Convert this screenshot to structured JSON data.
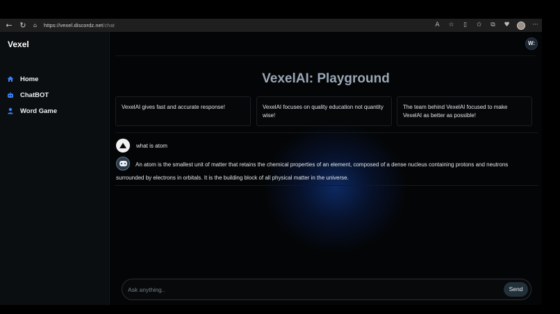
{
  "browser": {
    "back_glyph": "←",
    "refresh_glyph": "↻",
    "lock_glyph": "⌂",
    "url_host": "https://vexel.discordz.net",
    "url_path": "/chat",
    "tool_glyphs": [
      "A",
      "☆",
      "▯",
      "✩",
      "⧉",
      "♥"
    ],
    "menu_glyph": "···"
  },
  "sidebar": {
    "brand": "Vexel",
    "items": [
      {
        "label": "Home",
        "icon": "home-icon",
        "color": "#3b82f6"
      },
      {
        "label": "ChatBOT",
        "icon": "robot-icon",
        "color": "#3b82f6"
      },
      {
        "label": "Word Game",
        "icon": "user-icon",
        "color": "#3b82f6"
      }
    ]
  },
  "header": {
    "avatar_initial": "W:"
  },
  "main": {
    "title": "VexelAI: Playground",
    "cards": [
      "VexelAI gives fast and accurate response!",
      "VexelAI focuses on quality education not quantity wise!",
      "The team behind VexelAI focused to make VexelAI as better as possible!"
    ],
    "user_message": "what is atom",
    "bot_message": "An atom is the smallest unit of matter that retains the chemical properties of an element, composed of a dense nucleus containing protons and neutrons surrounded by electrons in orbitals. It is the building block of all physical matter in the universe."
  },
  "composer": {
    "placeholder": "Ask anything..",
    "send_label": "Send"
  },
  "colors": {
    "accent": "#3b82f6",
    "title": "#9aa7b6"
  }
}
